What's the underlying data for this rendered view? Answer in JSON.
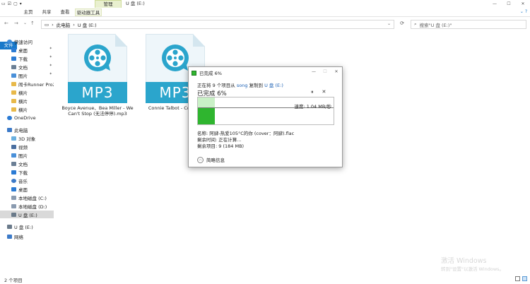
{
  "titlebar": {
    "manage_tab": "管理",
    "window_title": "U 盘 (E:)",
    "minimize": "—",
    "maximize": "☐",
    "close": "✕"
  },
  "ribbon": {
    "tabs": [
      "文件",
      "主页",
      "共享",
      "查看",
      "驱动器工具"
    ]
  },
  "address": {
    "path": [
      "此电脑",
      "U 盘 (E:)"
    ],
    "search_placeholder": "搜索\"U 盘 (E:)\""
  },
  "sidebar": {
    "items": [
      {
        "label": "快速访问",
        "color": "#3c8ad8"
      },
      {
        "label": "桌面",
        "color": "#2b7bd4"
      },
      {
        "label": "下载",
        "color": "#2b7bd4"
      },
      {
        "label": "文档",
        "color": "#6b7f95"
      },
      {
        "label": "图片",
        "color": "#4a90d9"
      },
      {
        "label": "闹卡Runner Pro2备",
        "color": "#e8b94a"
      },
      {
        "label": "横片",
        "color": "#e8b94a"
      },
      {
        "label": "横片",
        "color": "#e8b94a"
      },
      {
        "label": "横片",
        "color": "#e8b94a"
      },
      {
        "label": "OneDrive",
        "color": "#2b7bd4"
      },
      {
        "label": "此电脑",
        "color": "#3c7ac8"
      },
      {
        "label": "3D 对象",
        "color": "#6ab0e0"
      },
      {
        "label": "视频",
        "color": "#4a6fa0"
      },
      {
        "label": "图片",
        "color": "#4a90d9"
      },
      {
        "label": "文档",
        "color": "#6b7f95"
      },
      {
        "label": "下载",
        "color": "#2b7bd4"
      },
      {
        "label": "音乐",
        "color": "#3c7ac8"
      },
      {
        "label": "桌面",
        "color": "#2b7bd4"
      },
      {
        "label": "本地磁盘 (C:)",
        "color": "#8a9bb0"
      },
      {
        "label": "本地磁盘 (D:)",
        "color": "#8a9bb0"
      },
      {
        "label": "U 盘 (E:)",
        "color": "#6a7a8a"
      },
      {
        "label": "U 盘 (E:)",
        "color": "#6a7a8a"
      },
      {
        "label": "网络",
        "color": "#3c7ac8"
      }
    ]
  },
  "files": [
    {
      "badge": "MP3",
      "name_line1": "Boyce Avenue、Bea Miller - We",
      "name_line2": "Can't Stop (无法停停).mp3"
    },
    {
      "badge": "MP3",
      "name_line1": "Connie Talbot - Count C",
      "name_line2": ""
    }
  ],
  "dialog": {
    "title": "已完成 6%",
    "line1_prefix": "正在将 9 个项目从 ",
    "source": "song",
    "line1_mid": " 复制到 ",
    "dest": "U 盘 (E:)",
    "percent_text": "已完成 6%",
    "progress_fraction": 0.06,
    "pause": "⏸",
    "cancel": "✕",
    "speed": "速度: 1.04 MB/秒",
    "name_line": "名称: 阿肆-热爱105°C的你 (cover：阿肆).flac",
    "time_line": "剩余时间: 正在计算...",
    "items_line": "剩余项目: 9 (184 MB)",
    "less_info": "简略信息"
  },
  "watermark": {
    "line1": "激活 Windows",
    "line2": "转到\"设置\"以激活 Windows。"
  },
  "status": {
    "count": "2 个项目"
  }
}
